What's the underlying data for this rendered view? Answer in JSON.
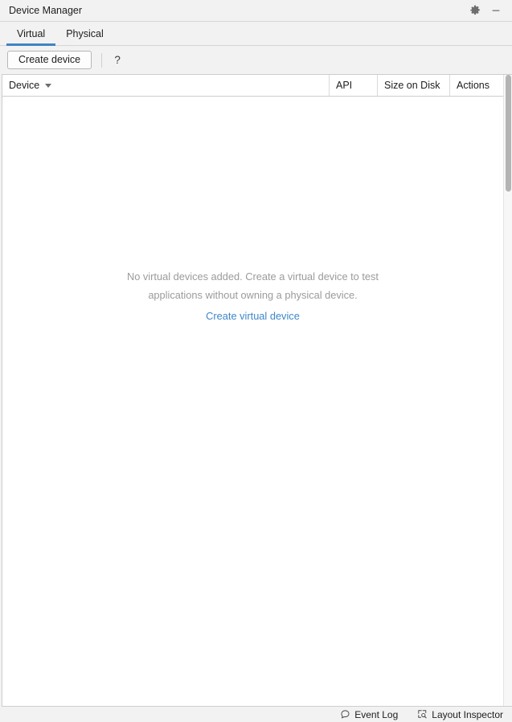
{
  "window": {
    "title": "Device Manager",
    "settings_icon": "gear-icon",
    "minimize_icon": "minimize-icon"
  },
  "tabs": [
    {
      "label": "Virtual",
      "active": true
    },
    {
      "label": "Physical",
      "active": false
    }
  ],
  "toolbar": {
    "create_device_label": "Create device",
    "help_label": "?"
  },
  "table": {
    "columns": [
      {
        "label": "Device",
        "sorted": true,
        "sort_direction": "desc"
      },
      {
        "label": "API",
        "sorted": false
      },
      {
        "label": "Size on Disk",
        "sorted": false
      },
      {
        "label": "Actions",
        "sorted": false
      }
    ],
    "rows": [],
    "empty_state": {
      "line1": "No virtual devices added. Create a virtual device to test",
      "line2": "applications without owning a physical device.",
      "link": "Create virtual device"
    }
  },
  "statusbar": {
    "items": [
      {
        "label": "Event Log",
        "icon": "event-log-icon"
      },
      {
        "label": "Layout Inspector",
        "icon": "layout-inspector-icon"
      }
    ]
  },
  "colors": {
    "accent_blue": "#4083c5",
    "link_blue": "#3e87c8",
    "empty_text": "#9b9b9b",
    "chrome_bg": "#f2f2f2",
    "content_bg": "#ffffff",
    "border": "#cdcdcd"
  }
}
